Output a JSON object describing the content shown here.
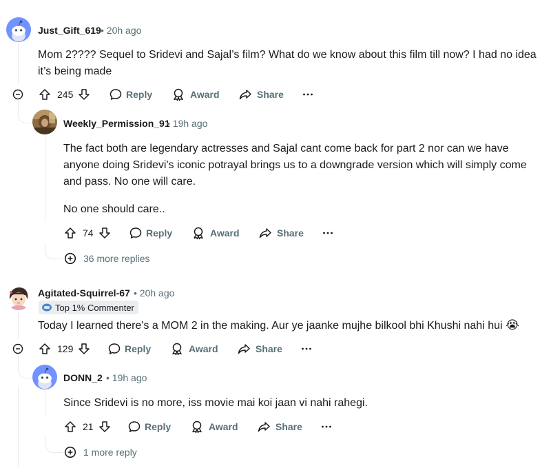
{
  "comments": [
    {
      "username": "Just_Gift_619",
      "time": "20h ago",
      "text_line1": "Mom 2???? Sequel to Sridevi and Sajal’s film? What do we know about this film till now? I had no idea",
      "text_line2": "it’s being made",
      "votes": "245",
      "reply_label": "Reply",
      "award_label": "Award",
      "share_label": "Share",
      "avatar_color": "#7193ff"
    },
    {
      "username": "Weekly_Permission_91",
      "time": "19h ago",
      "text_line1": "The fact both are legendary actresses and Sajal cant come back for part 2 nor can we have",
      "text_line2": "anyone doing Sridevi's iconic potrayal brings us to a downgrade version which will simply come",
      "text_line3": "and pass. No one will care.",
      "text_line4": "No one should care..",
      "votes": "74",
      "reply_label": "Reply",
      "award_label": "Award",
      "share_label": "Share",
      "more_replies": "36 more replies"
    },
    {
      "username": "Agitated-Squirrel-67",
      "time": "20h ago",
      "badge": "Top 1% Commenter",
      "text_line1": "Today I learned there's a MOM 2 in the making. Aur ye jaanke mujhe bilkool bhi Khushi nahi hui",
      "emoji": "😭",
      "votes": "129",
      "reply_label": "Reply",
      "award_label": "Award",
      "share_label": "Share"
    },
    {
      "username": "DONN_2",
      "time": "19h ago",
      "text_line1": "Since Sridevi is no more, iss movie mai koi jaan vi nahi rahegi.",
      "votes": "21",
      "reply_label": "Reply",
      "award_label": "Award",
      "share_label": "Share",
      "more_replies": "1 more reply",
      "avatar_color": "#7193ff"
    }
  ],
  "separator": "•",
  "colors": {
    "text": "#1a1a1b",
    "meta": "#576f76",
    "thread": "#e5ebee",
    "snoo_bg": "#7193ff"
  }
}
